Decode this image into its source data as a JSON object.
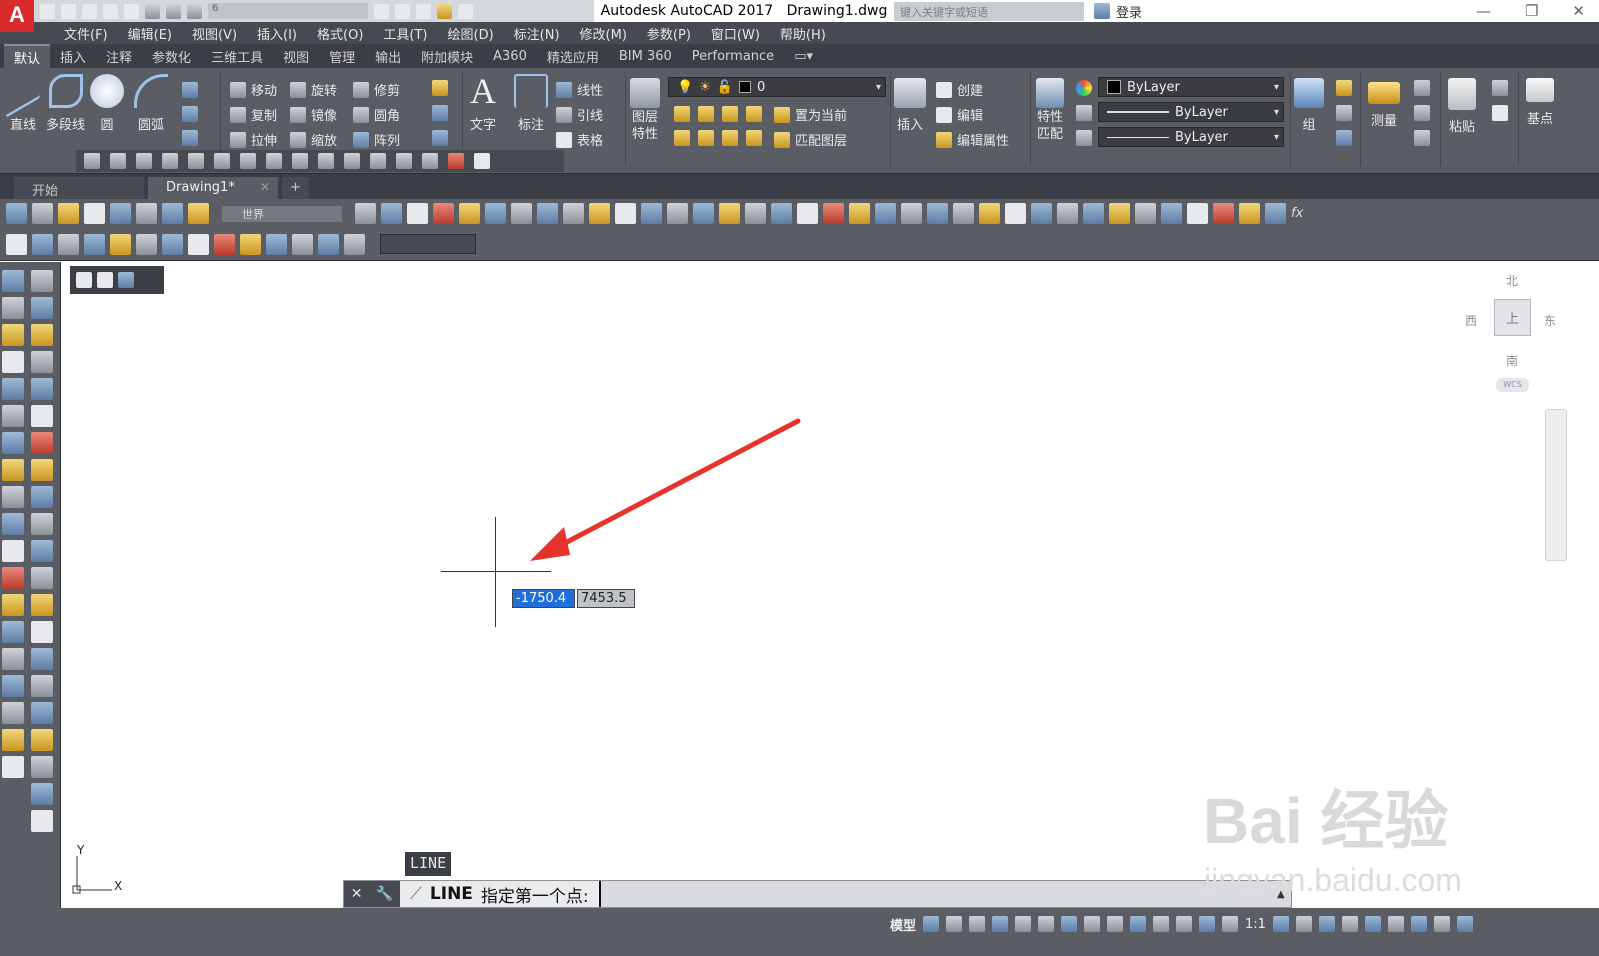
{
  "app": {
    "title": "Autodesk AutoCAD 2017",
    "document": "Drawing1.dwg",
    "logo_letter": "A",
    "search_placeholder": "键入关键字或短语",
    "login_label": "登录",
    "workspace_value": "6"
  },
  "menubar": [
    "文件(F)",
    "编辑(E)",
    "视图(V)",
    "插入(I)",
    "格式(O)",
    "工具(T)",
    "绘图(D)",
    "标注(N)",
    "修改(M)",
    "参数(P)",
    "窗口(W)",
    "帮助(H)"
  ],
  "ribbon_tabs": [
    "默认",
    "插入",
    "注释",
    "参数化",
    "三维工具",
    "视图",
    "管理",
    "输出",
    "附加模块",
    "A360",
    "精选应用",
    "BIM 360",
    "Performance"
  ],
  "ribbon": {
    "draw": [
      "直线",
      "多段线",
      "圆",
      "圆弧"
    ],
    "modify": {
      "move": "移动",
      "rotate": "旋转",
      "trim": "修剪",
      "copy": "复制",
      "mirror": "镜像",
      "fillet": "圆角",
      "stretch": "拉伸",
      "scale": "缩放",
      "array": "阵列"
    },
    "annotation": {
      "text": "文字",
      "dim": "标注",
      "linear": "线性",
      "leader": "引线",
      "table": "表格"
    },
    "layers": {
      "label1": "图层",
      "label2": "特性",
      "layer_value": "0",
      "set_current": "置为当前",
      "match_layer": "匹配图层"
    },
    "block": {
      "insert": "插入",
      "create": "创建",
      "edit": "编辑",
      "edit_attr": "编辑属性"
    },
    "properties": {
      "match1": "特性",
      "match2": "匹配",
      "color": "ByLayer",
      "linetype": "ByLayer",
      "lineweight": "ByLayer"
    },
    "groups": {
      "group": "组"
    },
    "utilities": {
      "measure": "测量"
    },
    "clipboard": {
      "paste": "粘贴"
    },
    "view": {
      "base": "基点"
    }
  },
  "doc_tabs": {
    "start": "开始",
    "drawing": "Drawing1*"
  },
  "toolbar": {
    "ucs_value": "世界"
  },
  "canvas": {
    "dyn_x": "-1750.4",
    "dyn_y": "7453.5",
    "ucs_y": "Y",
    "ucs_x": "X"
  },
  "viewcube": {
    "north": "北",
    "south": "南",
    "east": "东",
    "west": "西",
    "wcs": "WCS",
    "face": "上"
  },
  "command": {
    "history_cmd": "LINE",
    "prompt_cmd": "LINE",
    "prompt_text": "指定第一个点:"
  },
  "status": {
    "model": "模型",
    "scale": "1:1"
  },
  "watermark": {
    "brand": "Bai 经验",
    "url": "jingyan.baidu.com"
  },
  "colors": {
    "accent_red": "#e8322c",
    "ribbon_bg": "#5a5d63",
    "selection": "#1e6fd9"
  }
}
